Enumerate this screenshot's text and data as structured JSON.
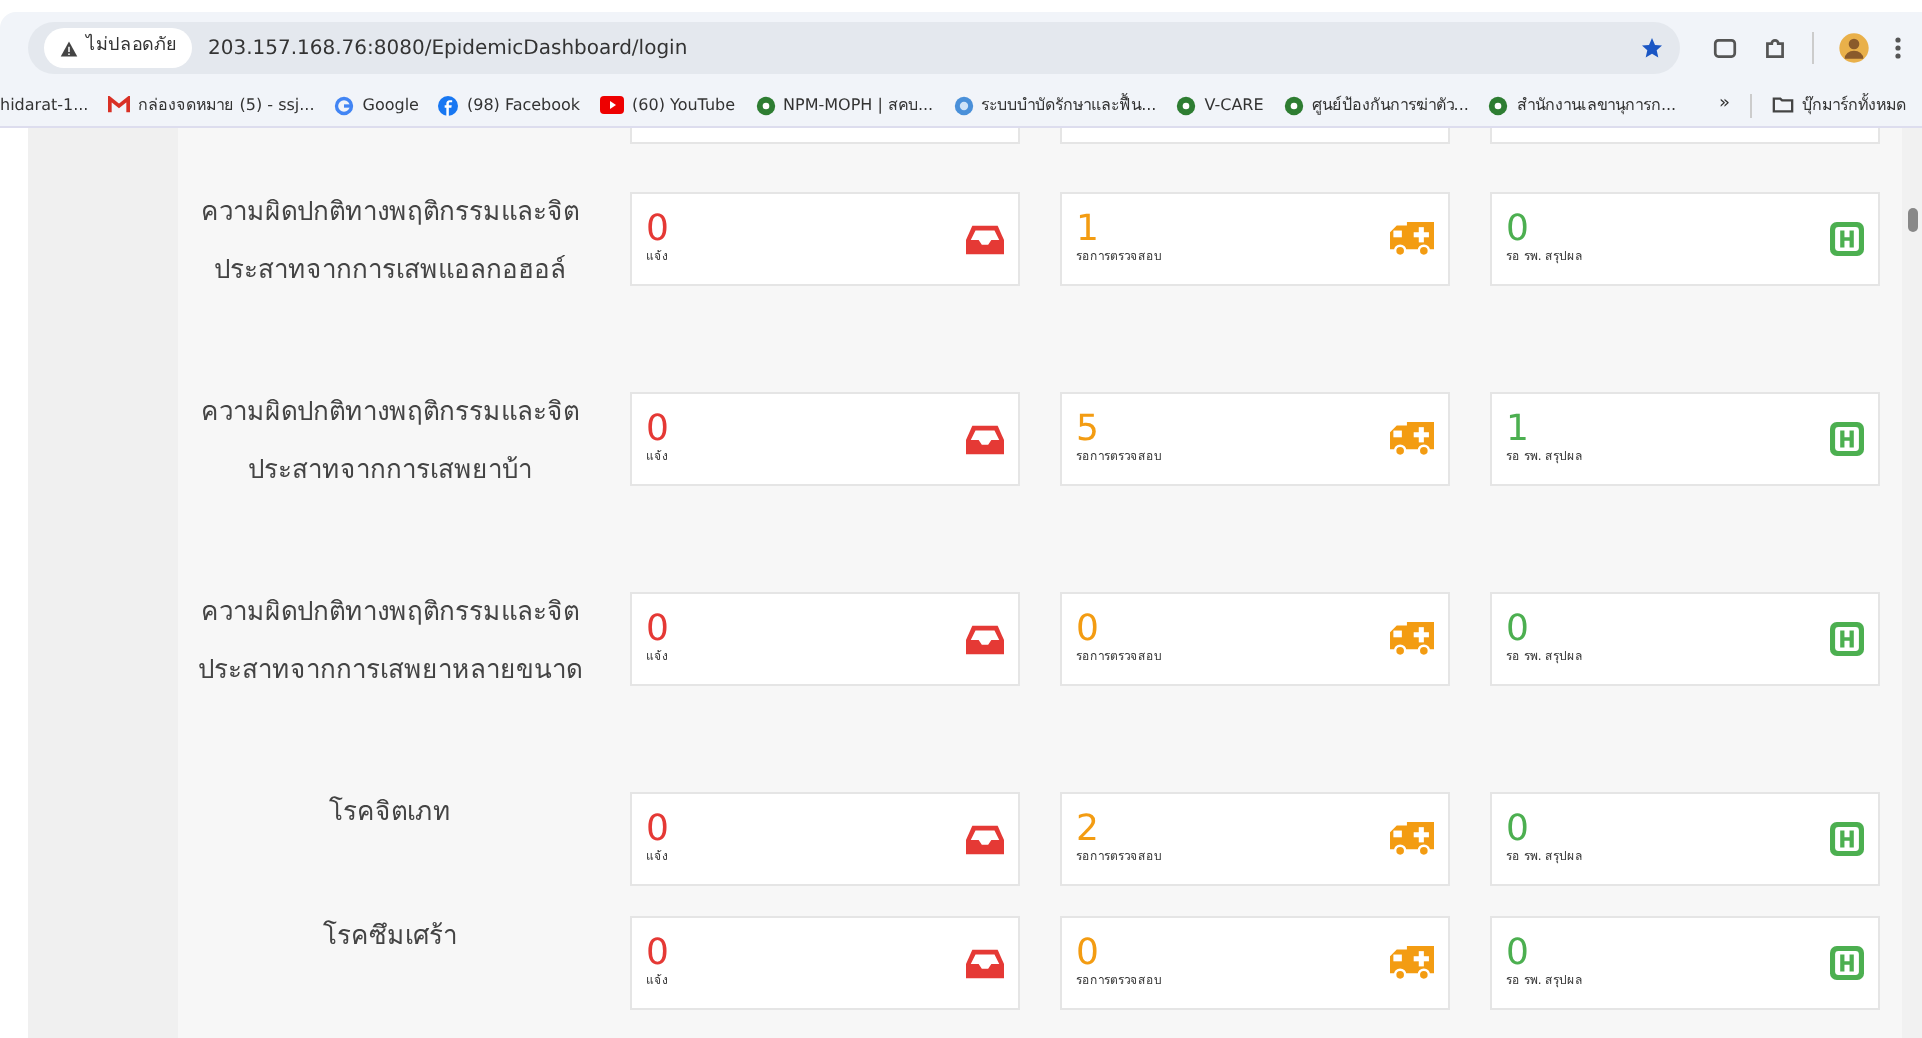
{
  "browser": {
    "security": "ไม่ปลอดภัย",
    "url": "203.157.168.76:8080/EpidemicDashboard/login",
    "bookmarks": [
      {
        "label": "hidarat-1...",
        "kind": "plain"
      },
      {
        "label": "กล่องจดหมาย (5) - ssj...",
        "kind": "mail"
      },
      {
        "label": "Google",
        "kind": "google"
      },
      {
        "label": "(98) Facebook",
        "kind": "facebook"
      },
      {
        "label": "(60) YouTube",
        "kind": "youtube"
      },
      {
        "label": "NPM-MOPH | สคบ...",
        "kind": "site"
      },
      {
        "label": "ระบบบำบัดรักษาและฟื้น...",
        "kind": "globe"
      },
      {
        "label": "V-CARE",
        "kind": "site"
      },
      {
        "label": "ศูนย์ป้องกันการฆ่าตัว...",
        "kind": "site"
      },
      {
        "label": "สำนักงานเลขานุการก...",
        "kind": "site"
      }
    ],
    "more": "»",
    "all_bookmarks": "บุ๊กมาร์กทั้งหมด"
  },
  "rows": [
    {
      "name": "ความผิดปกติทางพฤติกรรมและจิตประสาทจากการเสพแอลกอฮอล์",
      "cards": [
        {
          "kind": "report",
          "value": "0",
          "label": "แจ้ง"
        },
        {
          "kind": "review",
          "value": "1",
          "label": "รอการตรวจสอบ"
        },
        {
          "kind": "hospital",
          "value": "0",
          "label": "รอ รพ. สรุปผล"
        }
      ]
    },
    {
      "name": "ความผิดปกติทางพฤติกรรมและจิตประสาทจากการเสพยาบ้า",
      "cards": [
        {
          "kind": "report",
          "value": "0",
          "label": "แจ้ง"
        },
        {
          "kind": "review",
          "value": "5",
          "label": "รอการตรวจสอบ"
        },
        {
          "kind": "hospital",
          "value": "1",
          "label": "รอ รพ. สรุปผล"
        }
      ]
    },
    {
      "name": "ความผิดปกติทางพฤติกรรมและจิตประสาทจากการเสพยาหลายขนาด",
      "cards": [
        {
          "kind": "report",
          "value": "0",
          "label": "แจ้ง"
        },
        {
          "kind": "review",
          "value": "0",
          "label": "รอการตรวจสอบ"
        },
        {
          "kind": "hospital",
          "value": "0",
          "label": "รอ รพ. สรุปผล"
        }
      ]
    },
    {
      "name": "โรคจิตเภท",
      "cards": [
        {
          "kind": "report",
          "value": "0",
          "label": "แจ้ง"
        },
        {
          "kind": "review",
          "value": "2",
          "label": "รอการตรวจสอบ"
        },
        {
          "kind": "hospital",
          "value": "0",
          "label": "รอ รพ. สรุปผล"
        }
      ]
    },
    {
      "name": "โรคซึมเศร้า",
      "cards": [
        {
          "kind": "report",
          "value": "0",
          "label": "แจ้ง"
        },
        {
          "kind": "review",
          "value": "0",
          "label": "รอการตรวจสอบ"
        },
        {
          "kind": "hospital",
          "value": "0",
          "label": "รอ รพ. สรุปผล"
        }
      ]
    }
  ]
}
